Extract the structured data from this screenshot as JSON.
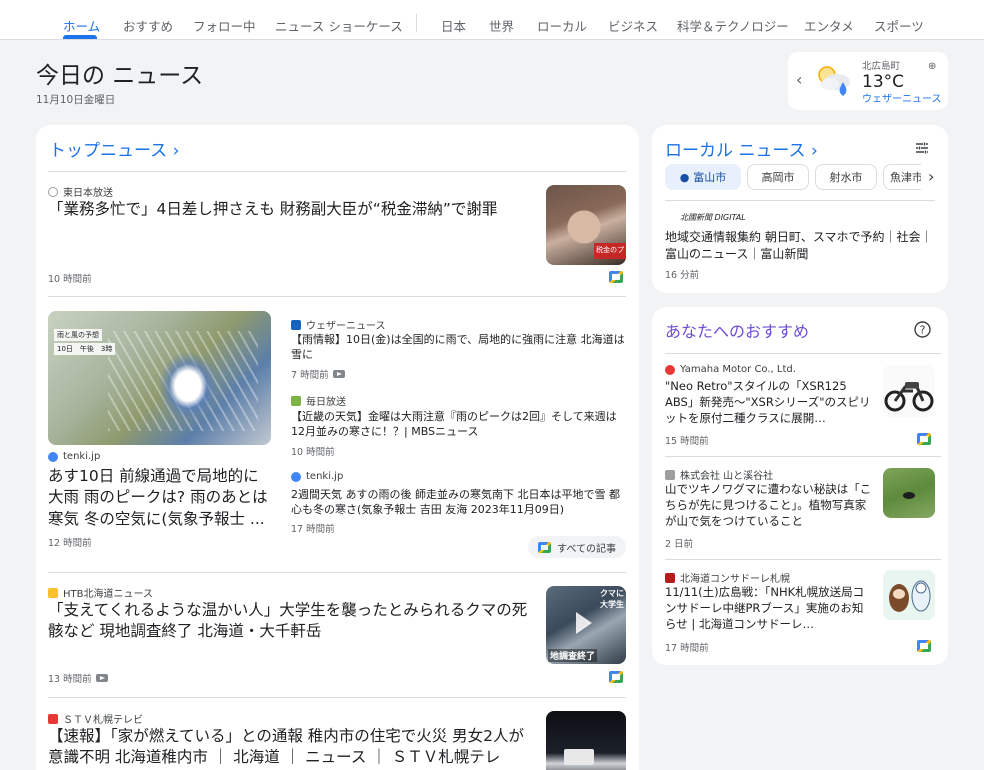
{
  "nav": {
    "tabs": [
      "ホーム",
      "おすすめ",
      "フォロー中",
      "ニュース ショーケース",
      "日本",
      "世界",
      "ローカル",
      "ビジネス",
      "科学＆テクノロジー",
      "エンタメ",
      "スポーツ"
    ],
    "active_index": 0
  },
  "header": {
    "title": "今日の ニュース",
    "date": "11月10日金曜日"
  },
  "weather": {
    "location": "北広島町",
    "temperature": "13°C",
    "source": "ウェザーニュース",
    "icon": "partly-cloudy-rain-icon"
  },
  "top_news": {
    "title": "トップニュース",
    "articles": [
      {
        "source": "東日本放送",
        "headline": "「業務多忙で」4日差し押さえも 財務副大臣が“税金滞納”で謝罪",
        "time": "10 時間前"
      },
      {
        "source": "tenki.jp",
        "headline": "あす10日 前線通過で局地的に大雨 雨のピークは? 雨のあとは寒気 冬の空気に(気象予報士 ...",
        "time": "12 時間前"
      },
      {
        "source": "ウェザーニュース",
        "headline": "【雨情報】10日(金)は全国的に雨で、局地的に強雨に注意 北海道は雪に",
        "time": "7 時間前"
      },
      {
        "source": "毎日放送",
        "headline": "【近畿の天気】金曜は大雨注意『雨のピークは2回』そして来週は12月並みの寒さに！？| MBSニュース",
        "time": "10 時間前"
      },
      {
        "source": "tenki.jp",
        "headline": "2週間天気 あすの雨の後 師走並みの寒気南下 北日本は平地で雪 都心も冬の寒さ(気象予報士 吉田 友海 2023年11月09日)",
        "time": "17 時間前"
      },
      {
        "source": "HTB北海道ニュース",
        "headline": "「支えてくれるような温かい人」大学生を襲ったとみられるクマの死骸など 現地調査終了 北海道・大千軒岳",
        "time": "13 時間前"
      },
      {
        "source": "ＳＴＶ札幌テレビ",
        "headline": "【速報】「家が燃えている」との通報 稚内市の住宅で火災 男女2人が意識不明 北海道稚内市 ｜ 北海道 ｜ ニュース ｜ ＳＴＶ札幌テレ",
        "time": ""
      }
    ],
    "all_articles_label": "すべての記事",
    "map_label_1": "雨と風の予想",
    "map_label_2": "10日　午後　3時",
    "thumb_text_1": "税金のプ",
    "thumb_text_2": "クマに",
    "thumb_text_3": "大学生",
    "thumb_text_4": "地調査終了"
  },
  "local_news": {
    "title": "ローカル ニュース",
    "chips": [
      "富山市",
      "高岡市",
      "射水市",
      "魚津市"
    ],
    "source": "北國新聞 DIGITAL",
    "headline": "地域交通情報集約 朝日町、スマホで予約｜社会｜富山のニュース｜富山新聞",
    "time": "16 分前"
  },
  "recommend": {
    "title": "あなたへのおすすめ",
    "articles": [
      {
        "source": "Yamaha Motor Co., Ltd.",
        "headline": "\"Neo Retro\"スタイルの「XSR125 ABS」新発売～\"XSRシリーズ\"のスピリットを原付二種クラスに展開…",
        "time": "15 時間前"
      },
      {
        "source": "株式会社 山と溪谷社",
        "headline": "山でツキノワグマに遭わない秘訣は「こちらが先に見つけること」。植物写真家が山で気をつけていること",
        "time": "2 日前"
      },
      {
        "source": "北海道コンサドーレ札幌",
        "headline": "11/11(土)広島戦：「NHK札幌放送局コンサドーレ中継PRブース」実施のお知らせ | 北海道コンサドーレ…",
        "time": "17 時間前"
      }
    ]
  },
  "colors": {
    "accent": "#1a73e8",
    "recommend_title": "#6f4dd6",
    "background": "#f1f3f4"
  }
}
